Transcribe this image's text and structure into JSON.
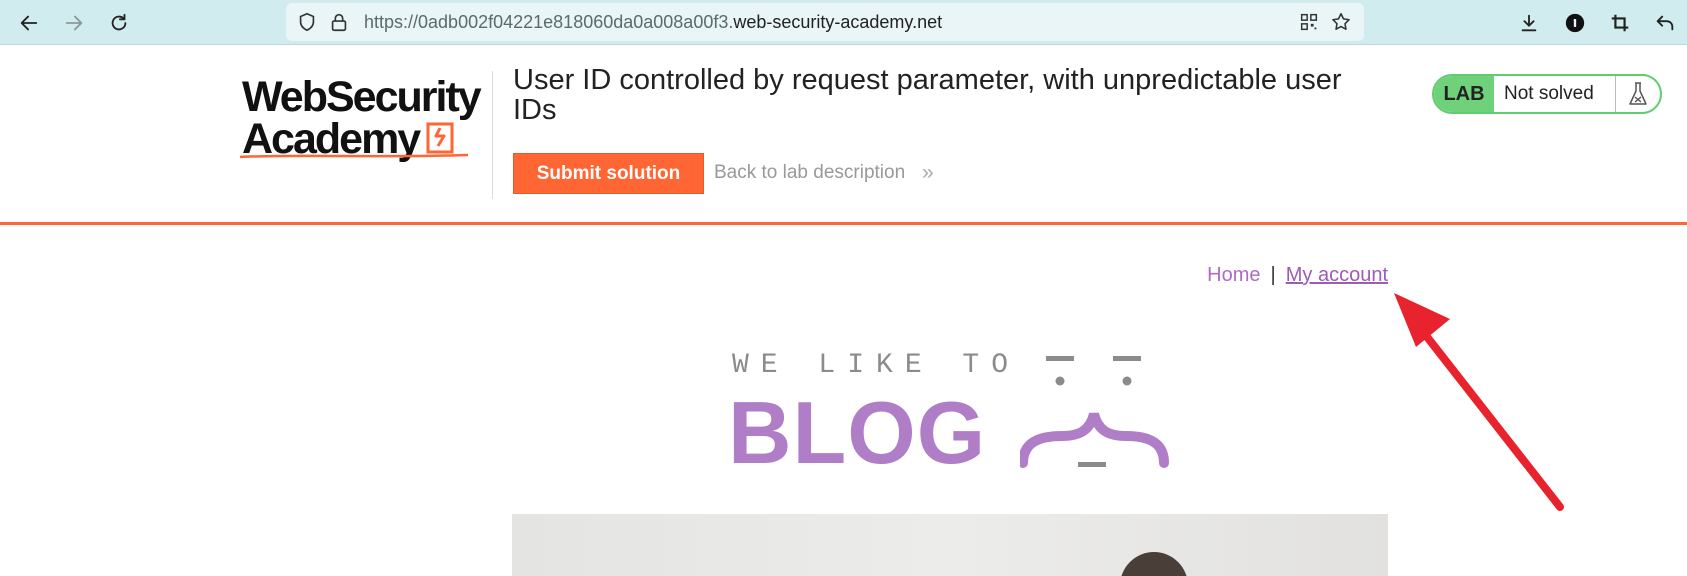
{
  "browser": {
    "url_prefix": "https://0adb002f04221e818060da0a008a00f3.",
    "url_domain": "web-security-academy.net",
    "icons": [
      "back-arrow-icon",
      "forward-arrow-icon",
      "reload-icon",
      "shield-icon",
      "lock-icon",
      "qr-code-icon",
      "star-icon",
      "download-icon",
      "password-manager-icon",
      "crop-icon",
      "undo-icon"
    ]
  },
  "lab_header": {
    "logo_line1": "WebSecurity",
    "logo_line2": "Academy",
    "title": "User ID controlled by request parameter, with unpredictable user IDs",
    "submit_label": "Submit solution",
    "back_label": "Back to lab description",
    "back_chevron": "»",
    "status_badge": "LAB",
    "status_text": "Not solved",
    "accent_color": "#ff6633",
    "status_color": "#70d17b"
  },
  "blog_nav": {
    "home": "Home",
    "separator": "|",
    "account": "My account"
  },
  "hero": {
    "tagline": "WE LIKE TO",
    "word": "BLOG",
    "brand_color": "#b07ec7"
  },
  "annotation": {
    "color": "#e8232d",
    "target": "My account"
  }
}
